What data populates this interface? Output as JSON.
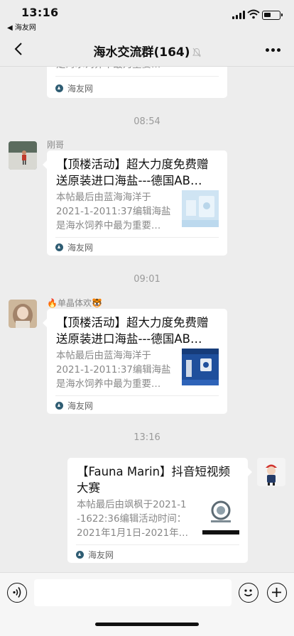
{
  "status_bar": {
    "time": "13:16",
    "back_app": "◀ 海友网"
  },
  "nav": {
    "title": "海水交流群(164)",
    "back_icon": "chevron-left-icon",
    "more_icon": "more-dots-icon",
    "mute_icon": "bell-muted-icon"
  },
  "messages": {
    "top_card": {
      "desc_tail": "是海水饲养中最为重要…",
      "source": "海友网"
    },
    "ts1": "08:54",
    "msg1": {
      "sender": "刚哥",
      "title_l1": "【顶楼活动】超大力度免费赠",
      "title_l2": "送原装进口海盐---德国AB…",
      "desc_l1": "本帖最后由蓝海海洋于",
      "desc_l2": "2021-1-2011:37编辑海盐",
      "desc_l3": "是海水饲养中最为重要…",
      "source": "海友网"
    },
    "ts2": "09:01",
    "msg2": {
      "sender": "🔥单晶体欢🐯",
      "title_l1": "【顶楼活动】超大力度免费赠",
      "title_l2": "送原装进口海盐---德国AB…",
      "desc_l1": "本帖最后由蓝海海洋于",
      "desc_l2": "2021-1-2011:37编辑海盐",
      "desc_l3": "是海水饲养中最为重要…",
      "source": "海友网"
    },
    "ts3": "13:16",
    "msg3": {
      "title_l1": "【Fauna Marin】抖音短视频",
      "title_l2": "大赛",
      "desc_l1": "本帖最后由飒枫于2021-1",
      "desc_l2": "-1622:36编辑活动时间：",
      "desc_l3": "2021年1月1日-2021年…",
      "source": "海友网"
    }
  },
  "input_bar": {
    "voice_icon": "voice-icon",
    "emoji_icon": "emoji-icon",
    "plus_icon": "plus-icon",
    "placeholder": ""
  },
  "colors": {
    "background": "#ededed",
    "card": "#ffffff",
    "muted_text": "#888888",
    "timestamp": "#9a9a9a"
  }
}
